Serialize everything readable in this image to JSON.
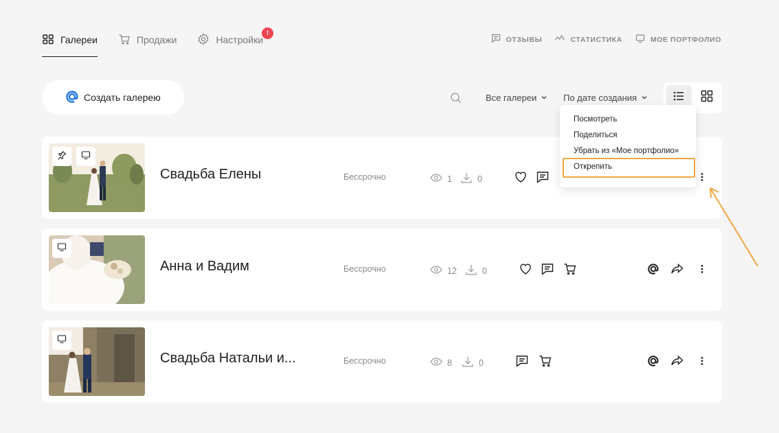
{
  "nav": {
    "tabs": [
      {
        "label": "Галереи",
        "icon": "grid-icon"
      },
      {
        "label": "Продажи",
        "icon": "cart-icon"
      },
      {
        "label": "Настройки",
        "icon": "gear-icon"
      }
    ],
    "settings_badge": "!",
    "right_links": [
      {
        "label": "ОТЗЫВЫ",
        "icon": "comment-icon"
      },
      {
        "label": "СТАТИСТИКА",
        "icon": "chart-icon"
      },
      {
        "label": "МОЕ ПОРТФОЛИО",
        "icon": "monitor-icon"
      }
    ]
  },
  "toolbar": {
    "create_label": "Создать галерею",
    "filter_all": "Все галереи",
    "sort_label": "По дате создания"
  },
  "galleries": [
    {
      "title": "Свадьба Елены",
      "expiry": "Бессрочно",
      "views": "1",
      "downloads": "0"
    },
    {
      "title": "Анна и Вадим",
      "expiry": "Бессрочно",
      "views": "12",
      "downloads": "0"
    },
    {
      "title": "Свадьба Натальи и...",
      "expiry": "Бессрочно",
      "views": "8",
      "downloads": "0"
    }
  ],
  "context_menu": {
    "items": [
      "Посмотреть",
      "Поделиться",
      "Убрать из «Мое портфолио»",
      "Открепить"
    ]
  },
  "colors": {
    "accent": "#1e1e1e",
    "badge": "#ef4452",
    "highlight": "#f0a640",
    "brand_at": "#1a73e8"
  }
}
